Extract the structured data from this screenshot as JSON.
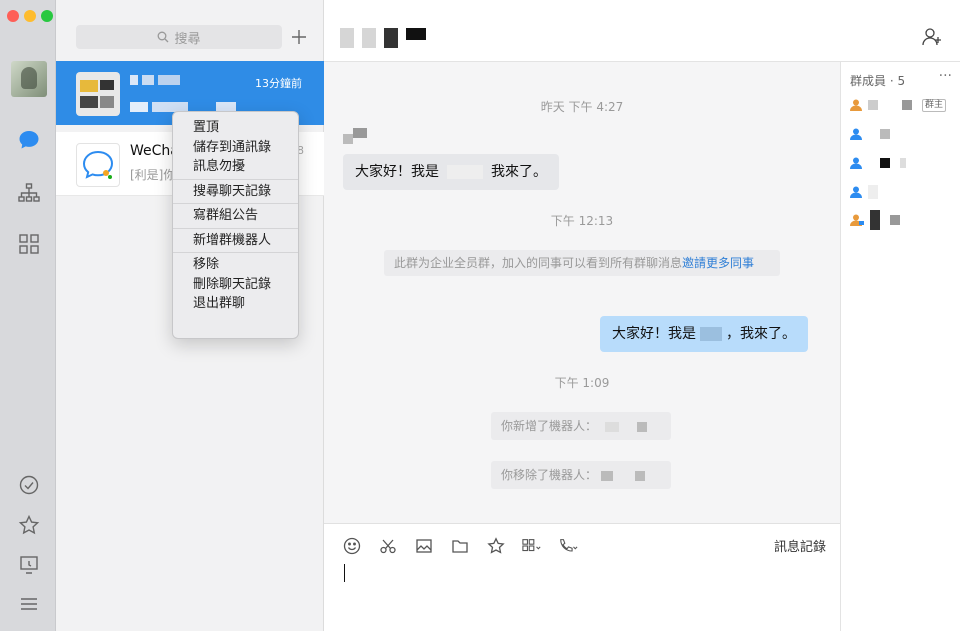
{
  "sidebar": {
    "icons": [
      "chat-icon",
      "org-chart-icon",
      "apps-grid-icon",
      "todo-check-icon",
      "favorites-star-icon",
      "screen-share-icon",
      "menu-icon"
    ]
  },
  "search": {
    "placeholder": "搜尋"
  },
  "conversations": [
    {
      "time": "13分鐘前"
    },
    {
      "name": "WeCha",
      "subtitle": "[利是]你",
      "time": "8"
    }
  ],
  "context_menu": {
    "groups": [
      [
        "置頂",
        "儲存到通訊錄",
        "訊息勿擾"
      ],
      [
        "搜尋聊天記錄"
      ],
      [
        "寫群組公告"
      ],
      [
        "新增群機器人"
      ],
      [
        "移除",
        "刪除聊天記錄",
        "退出群聊"
      ]
    ]
  },
  "messages": {
    "time1": "昨天 下午 4:27",
    "bubble_left_prefix": "大家好！我是",
    "bubble_left_suffix": "我來了。",
    "time2": "下午 12:13",
    "notice_text": "此群为企业全员群，加入的同事可以看到所有群聊消息",
    "notice_link": "邀請更多同事",
    "bubble_right_prefix": "大家好！我是",
    "bubble_right_suffix": "，我來了。",
    "time3": "下午 1:09",
    "sys_added": "你新增了機器人：",
    "sys_removed": "你移除了機器人："
  },
  "composer": {
    "history_label": "訊息記錄"
  },
  "members": {
    "title": "群成員 · 5",
    "more": "···",
    "owner_badge": "群主"
  }
}
